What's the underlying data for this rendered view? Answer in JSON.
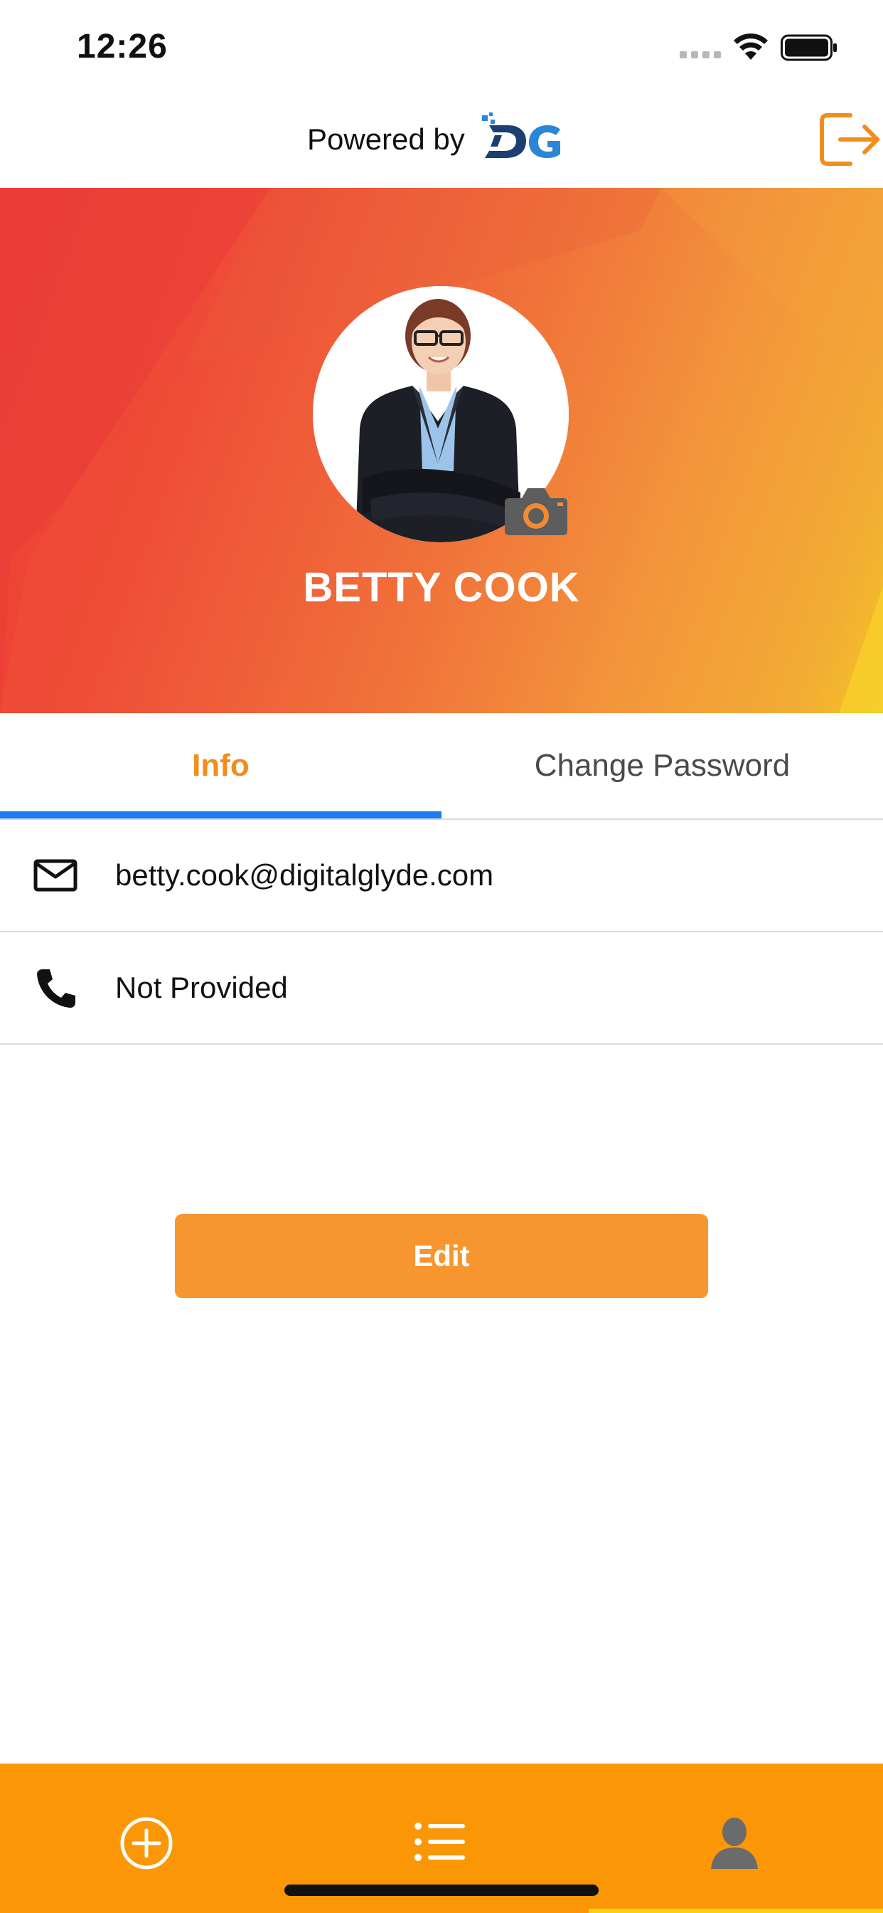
{
  "status_bar": {
    "time": "12:26"
  },
  "header": {
    "powered_by": "Powered by",
    "logo_text": "DG",
    "logout_icon": "logout-icon"
  },
  "profile": {
    "name": "BETTY COOK",
    "avatar_icon": "avatar-photo",
    "camera_icon": "camera-icon"
  },
  "tabs": [
    {
      "label": "Info",
      "active": true
    },
    {
      "label": "Change Password",
      "active": false
    }
  ],
  "info": {
    "email": {
      "icon": "mail-icon",
      "value": "betty.cook@digitalglyde.com"
    },
    "phone": {
      "icon": "phone-icon",
      "value": "Not Provided"
    }
  },
  "actions": {
    "edit_label": "Edit"
  },
  "tabbar": {
    "items": [
      {
        "icon": "add-circle-icon",
        "active": false
      },
      {
        "icon": "list-icon",
        "active": false
      },
      {
        "icon": "person-icon",
        "active": true
      }
    ]
  },
  "colors": {
    "accent": "#f7962f",
    "tabbar": "#fb9707",
    "tab_active_text": "#f28d1d",
    "tab_indicator": "#1a7cf0",
    "hero_start": "#ee4139",
    "hero_end": "#f5c326"
  }
}
